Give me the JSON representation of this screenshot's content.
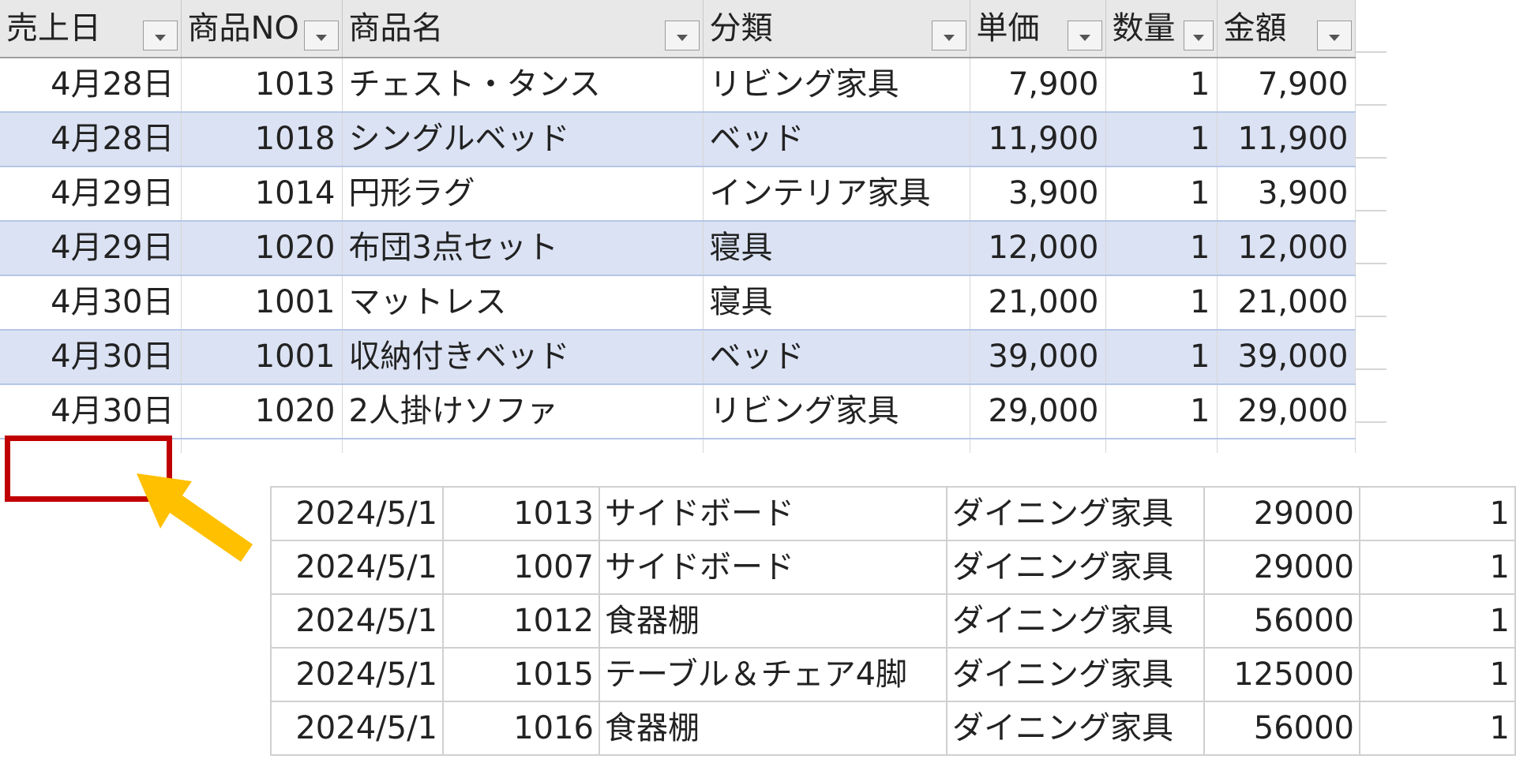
{
  "sheet": {
    "headers": [
      "売上日",
      "商品NO",
      "商品名",
      "分類",
      "単価",
      "数量",
      "金額"
    ],
    "rows": [
      {
        "date": "4月28日",
        "no": "1013",
        "name": "チェスト・タンス",
        "category": "リビング家具",
        "price": "7,900",
        "qty": "1",
        "amount": "7,900"
      },
      {
        "date": "4月28日",
        "no": "1018",
        "name": "シングルベッド",
        "category": "ベッド",
        "price": "11,900",
        "qty": "1",
        "amount": "11,900"
      },
      {
        "date": "4月29日",
        "no": "1014",
        "name": "円形ラグ",
        "category": "インテリア家具",
        "price": "3,900",
        "qty": "1",
        "amount": "3,900"
      },
      {
        "date": "4月29日",
        "no": "1020",
        "name": "布団3点セット",
        "category": "寝具",
        "price": "12,000",
        "qty": "1",
        "amount": "12,000"
      },
      {
        "date": "4月30日",
        "no": "1001",
        "name": "マットレス",
        "category": "寝具",
        "price": "21,000",
        "qty": "1",
        "amount": "21,000"
      },
      {
        "date": "4月30日",
        "no": "1001",
        "name": "収納付きベッド",
        "category": "ベッド",
        "price": "39,000",
        "qty": "1",
        "amount": "39,000"
      },
      {
        "date": "4月30日",
        "no": "1020",
        "name": "2人掛けソファ",
        "category": "リビング家具",
        "price": "29,000",
        "qty": "1",
        "amount": "29,000"
      }
    ]
  },
  "pasted": {
    "rows": [
      {
        "date": "2024/5/1",
        "no": "1013",
        "name": "サイドボード",
        "category": "ダイニング家具",
        "price": "29000",
        "qty": "1"
      },
      {
        "date": "2024/5/1",
        "no": "1007",
        "name": "サイドボード",
        "category": "ダイニング家具",
        "price": "29000",
        "qty": "1"
      },
      {
        "date": "2024/5/1",
        "no": "1012",
        "name": "食器棚",
        "category": "ダイニング家具",
        "price": "56000",
        "qty": "1"
      },
      {
        "date": "2024/5/1",
        "no": "1015",
        "name": "テーブル＆チェア4脚",
        "category": "ダイニング家具",
        "price": "125000",
        "qty": "1"
      },
      {
        "date": "2024/5/1",
        "no": "1016",
        "name": "食器棚",
        "category": "ダイニング家具",
        "price": "56000",
        "qty": "1"
      }
    ]
  },
  "colors": {
    "band": "#dbe2f3",
    "highlight_box": "#c00000",
    "arrow": "#ffc000"
  },
  "icons": {
    "filter": "filter-dropdown-icon",
    "arrow": "arrow-pointer-icon"
  }
}
